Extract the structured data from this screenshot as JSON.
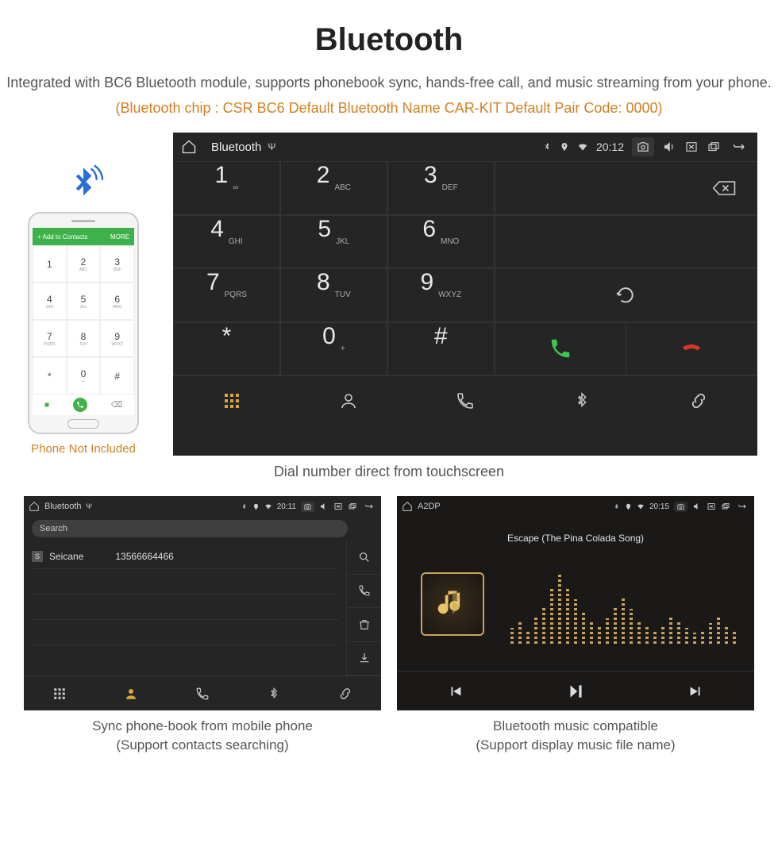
{
  "page": {
    "title": "Bluetooth",
    "description": "Integrated with BC6 Bluetooth module, supports phonebook sync, hands-free call, and music streaming from your phone.",
    "orange_info": "(Bluetooth chip : CSR BC6     Default Bluetooth Name CAR-KIT     Default Pair Code: 0000)"
  },
  "phone_mock": {
    "add_bar": "Add to Contacts",
    "add_menu": "MORE",
    "keys": [
      {
        "n": "1",
        "s": ""
      },
      {
        "n": "2",
        "s": "ABC"
      },
      {
        "n": "3",
        "s": "DEF"
      },
      {
        "n": "4",
        "s": "GHI"
      },
      {
        "n": "5",
        "s": "JKL"
      },
      {
        "n": "6",
        "s": "MNO"
      },
      {
        "n": "7",
        "s": "PQRS"
      },
      {
        "n": "8",
        "s": "TUV"
      },
      {
        "n": "9",
        "s": "WXYZ"
      },
      {
        "n": "*",
        "s": ""
      },
      {
        "n": "0",
        "s": "+"
      },
      {
        "n": "#",
        "s": ""
      }
    ],
    "caption": "Phone Not Included"
  },
  "main_device": {
    "status": {
      "title": "Bluetooth",
      "time": "20:12"
    },
    "keys": [
      {
        "n": "1",
        "s": "∞"
      },
      {
        "n": "2",
        "s": "ABC"
      },
      {
        "n": "3",
        "s": "DEF"
      },
      {
        "n": "4",
        "s": "GHI"
      },
      {
        "n": "5",
        "s": "JKL"
      },
      {
        "n": "6",
        "s": "MNO"
      },
      {
        "n": "7",
        "s": "PQRS"
      },
      {
        "n": "8",
        "s": "TUV"
      },
      {
        "n": "9",
        "s": "WXYZ"
      },
      {
        "n": "*",
        "s": ""
      },
      {
        "n": "0",
        "s": "+"
      },
      {
        "n": "#",
        "s": ""
      }
    ],
    "caption": "Dial number direct from touchscreen"
  },
  "contacts_panel": {
    "status": {
      "title": "Bluetooth",
      "time": "20:11"
    },
    "search_placeholder": "Search",
    "contact": {
      "initial": "S",
      "name": "Seicane",
      "phone": "13566664466"
    },
    "caption_line1": "Sync phone-book from mobile phone",
    "caption_line2": "(Support contacts searching)"
  },
  "music_panel": {
    "status": {
      "title": "A2DP",
      "time": "20:15"
    },
    "track_title": "Escape (The Pina Colada Song)",
    "caption_line1": "Bluetooth music compatible",
    "caption_line2": "(Support display music file name)"
  }
}
